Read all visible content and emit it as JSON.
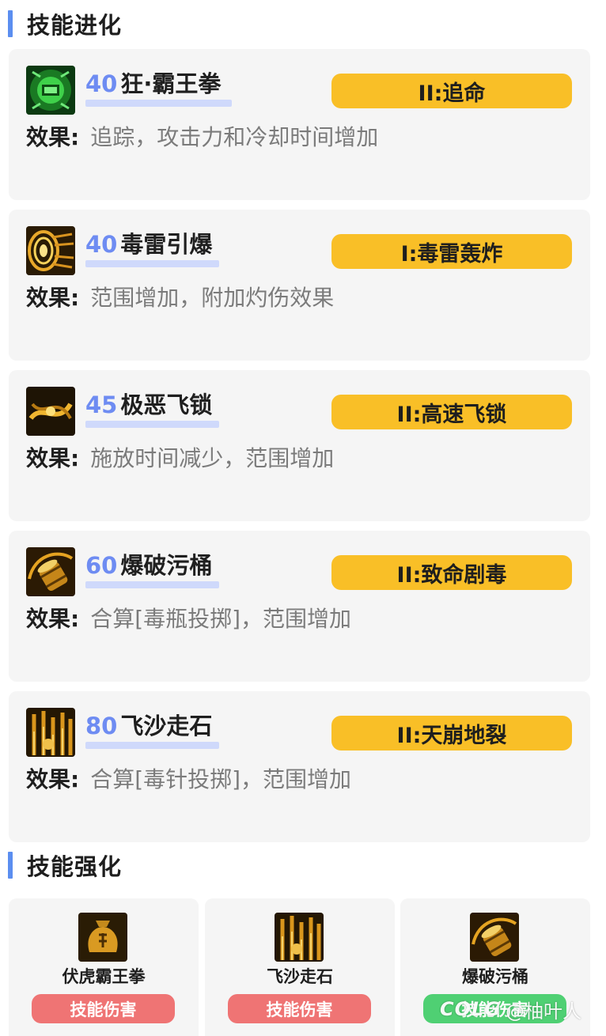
{
  "sections": {
    "evolution_title": "技能进化",
    "enhance_title": "技能强化"
  },
  "effect_label": "效果:",
  "skills": [
    {
      "level": "40",
      "name": "狂·霸王拳",
      "evolution": "II:追命",
      "effect": "追踪，攻击力和冷却时间增加",
      "icon": "fist-skill-icon"
    },
    {
      "level": "40",
      "name": "毒雷引爆",
      "evolution": "I:毒雷轰炸",
      "effect": "范围增加，附加灼伤效果",
      "icon": "explosion-skill-icon"
    },
    {
      "level": "45",
      "name": "极恶飞锁",
      "evolution": "II:高速飞锁",
      "effect": "施放时间减少，范围增加",
      "icon": "chain-skill-icon"
    },
    {
      "level": "60",
      "name": "爆破污桶",
      "evolution": "II:致命剧毒",
      "effect": "合算[毒瓶投掷]，范围增加",
      "icon": "barrel-skill-icon"
    },
    {
      "level": "80",
      "name": "飞沙走石",
      "evolution": "II:天崩地裂",
      "effect": "合算[毒针投掷]，范围增加",
      "icon": "sandstorm-skill-icon"
    }
  ],
  "enhancements": [
    {
      "name": "伏虎霸王拳",
      "tag": "技能伤害",
      "icon": "money-bag-skill-icon"
    },
    {
      "name": "飞沙走石",
      "tag": "技能伤害",
      "icon": "sandstorm-skill-icon"
    },
    {
      "name": "爆破污桶",
      "tag": "技能伤害",
      "icon": "barrel-skill-icon"
    }
  ],
  "watermark": {
    "logo": "COLG",
    "user": "@柚叶人"
  },
  "colors": {
    "accent_bar": "#5b8ef0",
    "level_text": "#6e8cf2",
    "evolution_badge": "#f9bf27",
    "damage_tag": "#ef7474",
    "green_tag": "#4fd073",
    "card_bg": "#f5f5f5"
  }
}
